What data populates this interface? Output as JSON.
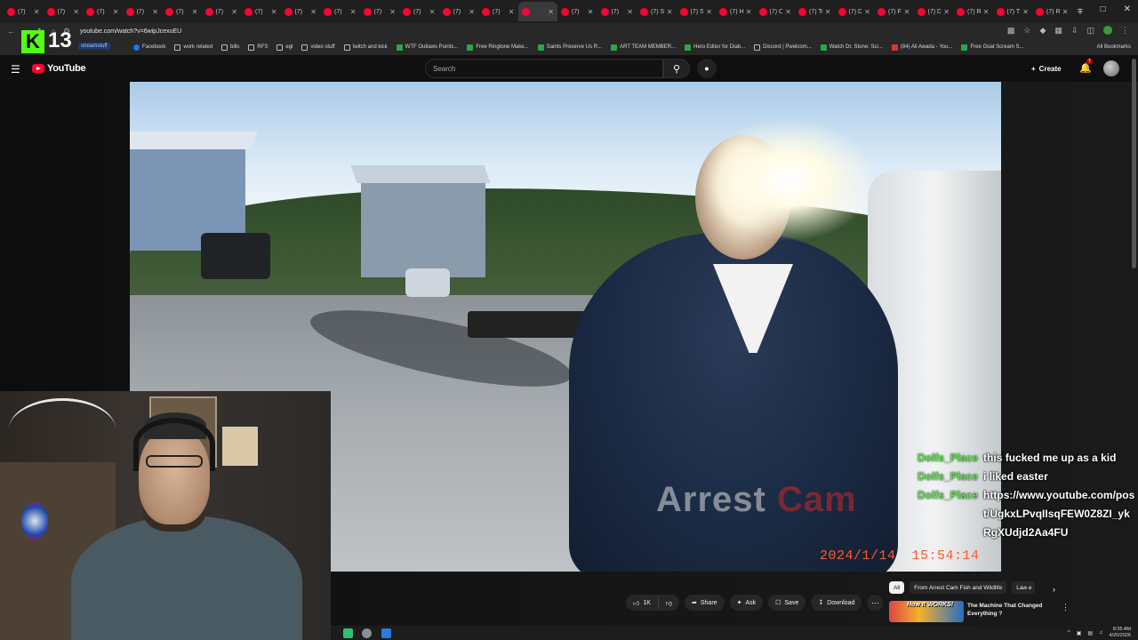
{
  "browser": {
    "tabs": [
      {
        "label": "(7)",
        "active": false
      },
      {
        "label": "(7)",
        "active": false
      },
      {
        "label": "(7)",
        "active": false
      },
      {
        "label": "(7)",
        "active": false
      },
      {
        "label": "(7)",
        "active": false
      },
      {
        "label": "(7)",
        "active": false
      },
      {
        "label": "(7)",
        "active": false
      },
      {
        "label": "(7)",
        "active": false
      },
      {
        "label": "(7)",
        "active": false
      },
      {
        "label": "(7)",
        "active": false
      },
      {
        "label": "(7)",
        "active": false
      },
      {
        "label": "(7)",
        "active": false
      },
      {
        "label": "(7)",
        "active": false
      },
      {
        "label": "",
        "active": true
      },
      {
        "label": "(7)",
        "active": false
      },
      {
        "label": "(7)",
        "active": false
      },
      {
        "label": "(7) She",
        "active": false
      },
      {
        "label": "(7) Spo",
        "active": false
      },
      {
        "label": "(7) Her",
        "active": false
      },
      {
        "label": "(7) Cod",
        "active": false
      },
      {
        "label": "(7) Tec",
        "active": false
      },
      {
        "label": "(7) Driv",
        "active": false
      },
      {
        "label": "(7) Flirt",
        "active": false
      },
      {
        "label": "(7) Dev",
        "active": false
      },
      {
        "label": "(7) Ron",
        "active": false
      },
      {
        "label": "(7) The",
        "active": false
      },
      {
        "label": "(7) Rec",
        "active": false
      }
    ],
    "new_tab": "+",
    "url": "youtube.com/watch?v=6wipJcexuEU",
    "bookmarks": [
      {
        "label": "Facebook",
        "icon": "facebook-icon"
      },
      {
        "label": "work related",
        "icon": "folder-icon"
      },
      {
        "label": "bills",
        "icon": "folder-icon"
      },
      {
        "label": "RFS",
        "icon": "folder-icon"
      },
      {
        "label": "egl",
        "icon": "folder-icon"
      },
      {
        "label": "video stuff",
        "icon": "folder-icon"
      },
      {
        "label": "twitch and kick",
        "icon": "folder-icon"
      },
      {
        "label": "WTF Outlaws Points...",
        "icon": "site-icon"
      },
      {
        "label": "Free Ringtone Make...",
        "icon": "site-icon"
      },
      {
        "label": "Saints Preserve Us R...",
        "icon": "site-icon"
      },
      {
        "label": "ART TEAM MEMBER...",
        "icon": "site-icon"
      },
      {
        "label": "Hero Editor for Diab...",
        "icon": "site-icon"
      },
      {
        "label": "Discord | Pwelcom...",
        "icon": "discord-icon"
      },
      {
        "label": "Watch Dr. Stone: Sci...",
        "icon": "site-icon"
      },
      {
        "label": "(84) Ali Awada - You...",
        "icon": "youtube-icon"
      },
      {
        "label": "Free Goat Scream S...",
        "icon": "site-icon"
      }
    ],
    "all_bookmarks": "All Bookmarks",
    "streamstuff": "streamstuff"
  },
  "overlay": {
    "kick_logo": "K",
    "viewer_count": "13"
  },
  "youtube": {
    "logo_text": "YouTube",
    "search_placeholder": "Search",
    "create_label": "Create",
    "notif_count": "7"
  },
  "video": {
    "watermark_left": "Arrest ",
    "watermark_right": "Cam",
    "timestamp_date": "2024/1/14",
    "timestamp_time": "15:54:14"
  },
  "chat": [
    {
      "user": "Dolfs_Place",
      "text": "this fucked me up as a kid"
    },
    {
      "user": "Dolfs_Place",
      "text": "i liked easter"
    },
    {
      "user": "Dolfs_Place",
      "text": "https://www.youtube.com/post/UgkxLPvqIIsqFEW0Z8ZI_ykRgXUdjd2Aa4FU"
    }
  ],
  "actions": {
    "likes": "1K",
    "share": "Share",
    "ask": "Ask",
    "save": "Save",
    "download": "Download"
  },
  "chips": [
    "All",
    "From Arrest Cam Fish and Wildlife",
    "Law e"
  ],
  "recommended": {
    "thumb_text": "How It WORKS!",
    "title": "The Machine That Changed Everything ?"
  },
  "taskbar": {
    "time": "8:35 AM",
    "date": "4/20/2026"
  },
  "colors": {
    "youtube_red": "#ff0033",
    "chat_username": "#5be04a",
    "timestamp_overlay": "#ff5a2a",
    "kick_green": "#53fc18"
  }
}
